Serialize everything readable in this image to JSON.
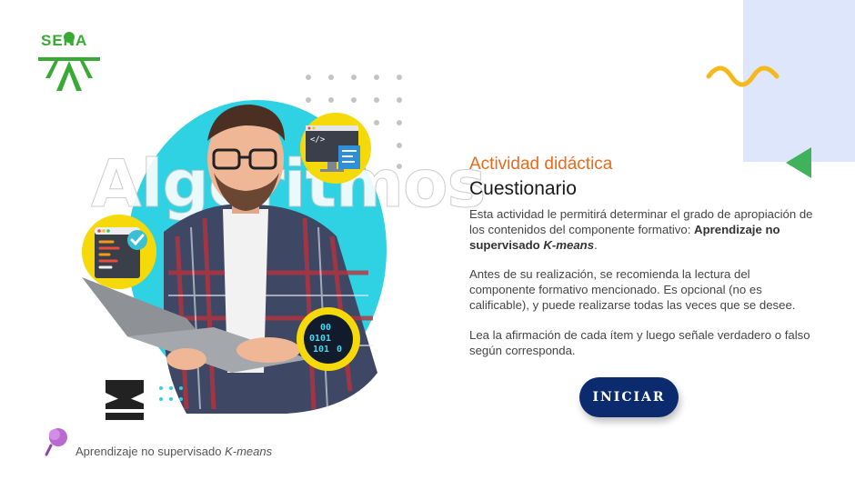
{
  "brand": {
    "name": "SENA",
    "color": "#39a935"
  },
  "watermark": "Algoritmos",
  "activity": {
    "kicker": "Actividad didáctica",
    "title": "Cuestionario",
    "p1_start": "Esta actividad le permitirá determinar el grado de apropiación de los contenidos del componente formativo: ",
    "p1_bold": "Aprendizaje no supervisado ",
    "p1_bold_italic": "K-means",
    "p1_end": ".",
    "p2": "Antes de su realización, se recomienda la lectura del componente formativo mencionado.  Es opcional (no es calificable), y puede realizarse todas las veces que se desee.",
    "p3": "Lea la afirmación de cada ítem y luego señale verdadero o falso según corresponda."
  },
  "start_button": {
    "label": "INICIAR",
    "color": "#0c2a6e"
  },
  "footer": {
    "text": "Aprendizaje no supervisado ",
    "italic": "K-means"
  },
  "binary_text": [
    "00",
    "0101",
    "101",
    "0"
  ],
  "colors": {
    "accent_orange": "#e86a1c",
    "cyan": "#2fd2e3",
    "yellow": "#f5d90a",
    "light_blue": "#dde6fb"
  },
  "icons": [
    "sena-logo-icon",
    "squiggle-icon",
    "triangle-icon",
    "code-window-icon",
    "checkmark-icon",
    "binary-icon",
    "m-logo-icon",
    "pushpin-icon"
  ]
}
